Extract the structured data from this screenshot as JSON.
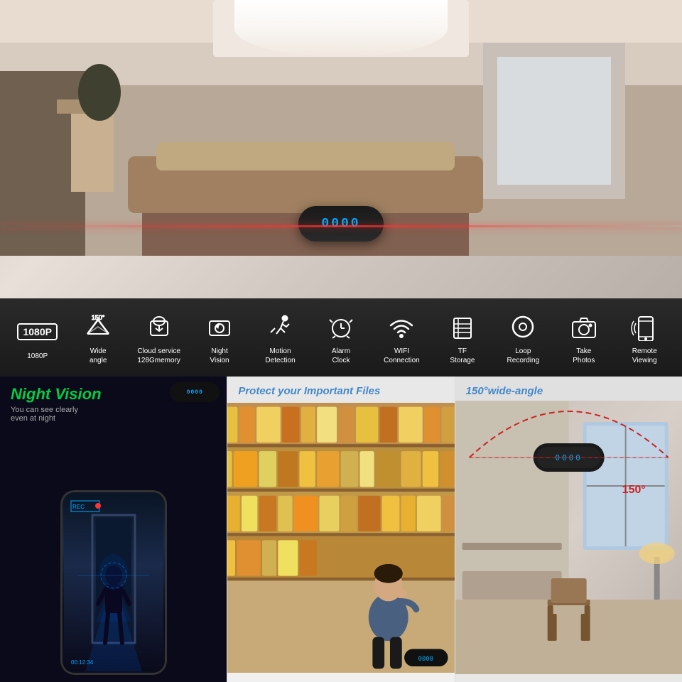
{
  "hero": {
    "clock_display": "0000"
  },
  "features": [
    {
      "id": "resolution",
      "label": "1080P",
      "icon_type": "badge"
    },
    {
      "id": "wide-angle",
      "label": "Wide\nangle",
      "icon_type": "wifi-like",
      "sub": "150°"
    },
    {
      "id": "cloud",
      "label": "Cloud service\n128Gmemory",
      "icon_type": "cloud"
    },
    {
      "id": "night-vision",
      "label": "Night\nVision",
      "icon_type": "night"
    },
    {
      "id": "motion",
      "label": "Motion\nDetection",
      "icon_type": "motion"
    },
    {
      "id": "alarm",
      "label": "Alarm\nClock",
      "icon_type": "alarm"
    },
    {
      "id": "wifi",
      "label": "WIFI\nConnection",
      "icon_type": "wifi"
    },
    {
      "id": "storage",
      "label": "TF\nStorage",
      "icon_type": "storage"
    },
    {
      "id": "loop",
      "label": "Loop\nRecording",
      "icon_type": "loop"
    },
    {
      "id": "photos",
      "label": "Take\nPhotos",
      "icon_type": "camera"
    },
    {
      "id": "remote",
      "label": "Remote\nViewing",
      "icon_type": "phone"
    }
  ],
  "panels": {
    "night_vision": {
      "title": "Night Vision",
      "subtitle": "You can see clearly\neven at night",
      "clock_display": "0000"
    },
    "files": {
      "title": "Protect your Important Files",
      "clock_display": "0000"
    },
    "angle": {
      "title": "150°wide-angle",
      "angle_label": "150°",
      "clock_display": "0000"
    }
  }
}
